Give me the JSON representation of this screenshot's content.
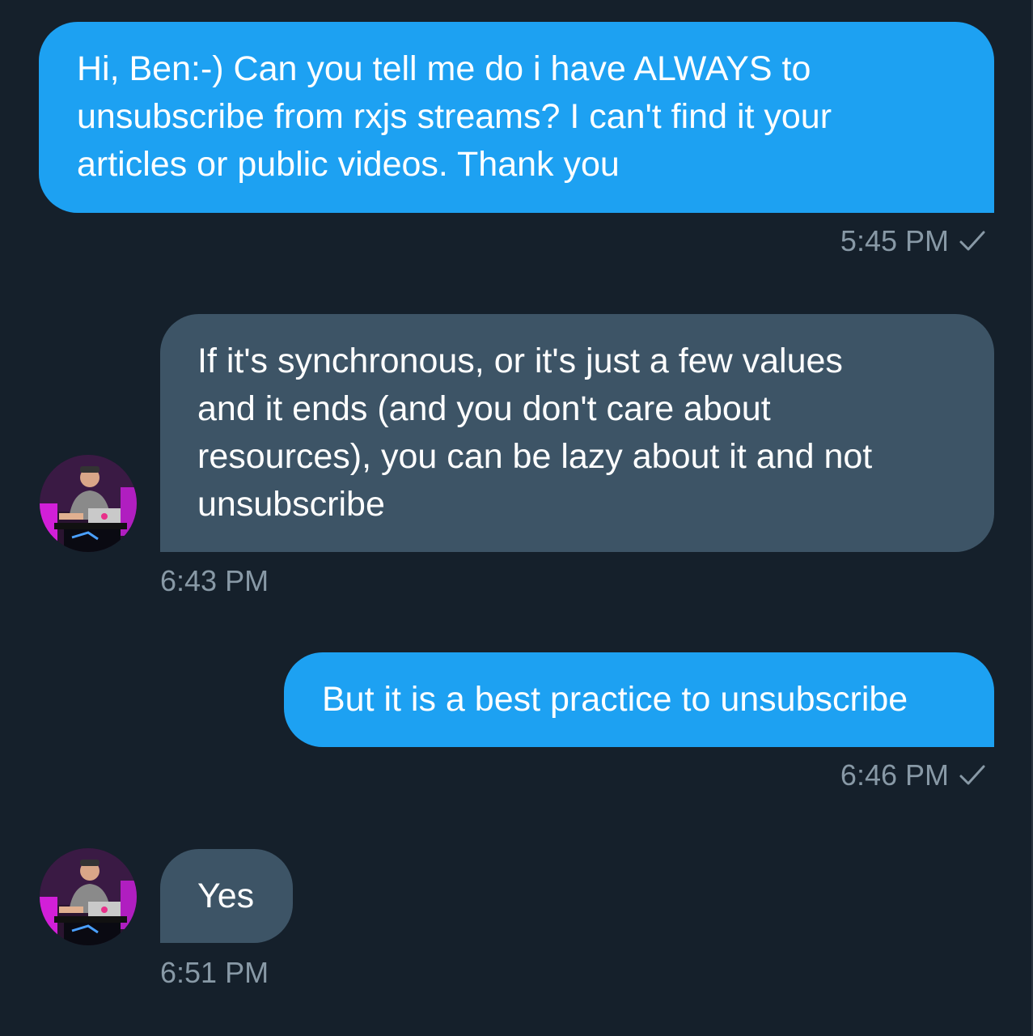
{
  "conversation": {
    "messages": [
      {
        "direction": "outgoing",
        "text": "Hi, Ben:-) Can you tell me do i have ALWAYS to\nunsubscribe from rxjs streams? I can't find it your\narticles or public videos. Thank you",
        "time": "5:45 PM",
        "status_icon": "check-icon"
      },
      {
        "direction": "incoming",
        "text": "If it's synchronous, or it's just a few values\nand it ends (and you don't care about\nresources), you can be lazy about it and not\nunsubscribe",
        "time": "6:43 PM",
        "avatar_icon": "avatar"
      },
      {
        "direction": "outgoing",
        "text": "But it is a best practice to unsubscribe",
        "time": "6:46 PM",
        "status_icon": "check-icon"
      },
      {
        "direction": "incoming",
        "text": "Yes",
        "time": "6:51 PM",
        "avatar_icon": "avatar"
      }
    ]
  },
  "colors": {
    "background": "#15202b",
    "outgoing_bubble": "#1da1f2",
    "incoming_bubble": "#3d5466",
    "timestamp_text": "#8899a6",
    "message_text": "#ffffff"
  }
}
